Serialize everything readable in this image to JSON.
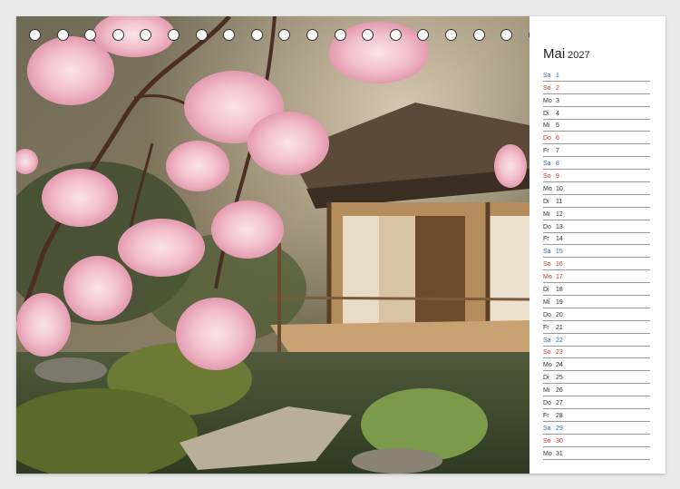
{
  "calendar": {
    "month": "Mai",
    "year": "2027",
    "colors": {
      "saturday": "#3a6fb0",
      "sunday": "#c0392b",
      "weekday": "#333333"
    },
    "days": [
      {
        "abbr": "Sa",
        "num": "1",
        "type": "sat"
      },
      {
        "abbr": "So",
        "num": "2",
        "type": "sun"
      },
      {
        "abbr": "Mo",
        "num": "3",
        "type": "wd"
      },
      {
        "abbr": "Di",
        "num": "4",
        "type": "wd"
      },
      {
        "abbr": "Mi",
        "num": "5",
        "type": "wd"
      },
      {
        "abbr": "Do",
        "num": "6",
        "type": "sun"
      },
      {
        "abbr": "Fr",
        "num": "7",
        "type": "wd"
      },
      {
        "abbr": "Sa",
        "num": "8",
        "type": "sat"
      },
      {
        "abbr": "So",
        "num": "9",
        "type": "sun"
      },
      {
        "abbr": "Mo",
        "num": "10",
        "type": "wd"
      },
      {
        "abbr": "Di",
        "num": "11",
        "type": "wd"
      },
      {
        "abbr": "Mi",
        "num": "12",
        "type": "wd"
      },
      {
        "abbr": "Do",
        "num": "13",
        "type": "wd"
      },
      {
        "abbr": "Fr",
        "num": "14",
        "type": "wd"
      },
      {
        "abbr": "Sa",
        "num": "15",
        "type": "sat"
      },
      {
        "abbr": "So",
        "num": "16",
        "type": "sun"
      },
      {
        "abbr": "Mo",
        "num": "17",
        "type": "sun"
      },
      {
        "abbr": "Di",
        "num": "18",
        "type": "wd"
      },
      {
        "abbr": "Mi",
        "num": "19",
        "type": "wd"
      },
      {
        "abbr": "Do",
        "num": "20",
        "type": "wd"
      },
      {
        "abbr": "Fr",
        "num": "21",
        "type": "wd"
      },
      {
        "abbr": "Sa",
        "num": "22",
        "type": "sat"
      },
      {
        "abbr": "So",
        "num": "23",
        "type": "sun"
      },
      {
        "abbr": "Mo",
        "num": "24",
        "type": "wd"
      },
      {
        "abbr": "Di",
        "num": "25",
        "type": "wd"
      },
      {
        "abbr": "Mi",
        "num": "26",
        "type": "wd"
      },
      {
        "abbr": "Do",
        "num": "27",
        "type": "wd"
      },
      {
        "abbr": "Fr",
        "num": "28",
        "type": "wd"
      },
      {
        "abbr": "Sa",
        "num": "29",
        "type": "sat"
      },
      {
        "abbr": "So",
        "num": "30",
        "type": "sun"
      },
      {
        "abbr": "Mo",
        "num": "31",
        "type": "wd"
      }
    ]
  },
  "binding": {
    "ring_count": 23
  },
  "photo": {
    "icon": "cherry-blossom-teahouse-photo"
  }
}
